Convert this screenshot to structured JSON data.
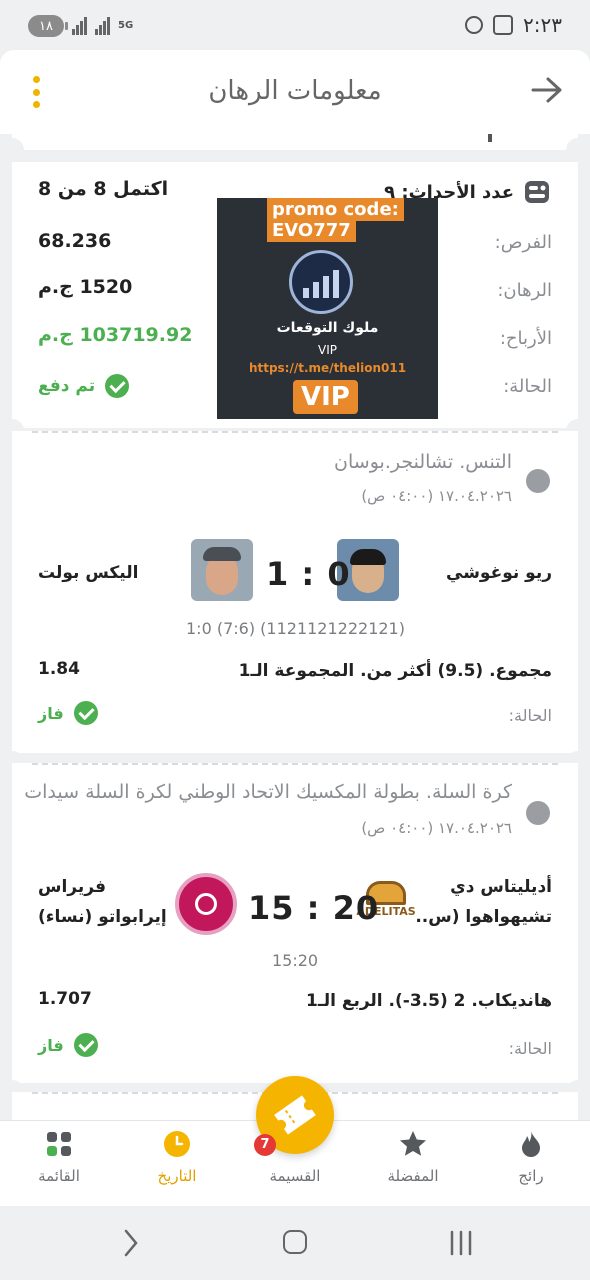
{
  "status_bar": {
    "battery": "١٨",
    "network": "5G",
    "time": "٢:٢٣"
  },
  "header": {
    "title": "معلومات الرهان"
  },
  "summary": {
    "events_label": "عدد الأحداث: ٩",
    "completed": "اكتمل 8 من 8",
    "odds_label": "الفرص:",
    "odds_value": "68.236",
    "stake_label": "الرهان:",
    "stake_value": "1520 ج.م",
    "winnings_label": "الأرباح:",
    "winnings_value": "103719.92 ج.م",
    "status_label": "الحالة:",
    "status_value": "تم دفع"
  },
  "promo": {
    "line1": "promo code:",
    "line2": "EVO777",
    "name": "ملوك التوقعات",
    "vip_small": "VIP",
    "url": "https://t.me/thelion011",
    "vip_big": "VIP"
  },
  "events": [
    {
      "title": "التنس. تشالنجر.بوسان",
      "date": "١٧.٠٤.٢٠٢٦ (٠٤:٠٠ ص)",
      "team1": "ريو نوغوشي",
      "team2": "اليكس بولت",
      "score": "1 : 0",
      "subscore": "1:0 (7:6) (1121121222121)",
      "market": "مجموع. (9.5) أكثر من. المجموعة الـ1",
      "odd": "1.84",
      "status_label": "الحالة:",
      "status_value": "فاز"
    },
    {
      "title": "كرة السلة. بطولة المكسيك الاتحاد الوطني لكرة السلة سيدات",
      "date": "١٧.٠٤.٢٠٢٦ (٠٤:٠٠ ص)",
      "team1_line1": "أديليتاس دي",
      "team1_line2": "تشيهواهوا (س..",
      "team2_line1": "فريراس",
      "team2_line2": "إيرابواتو (نساء)",
      "team1_logo": "ADELITAS",
      "score": "15 : 20",
      "subscore": "15:20",
      "market": "هانديكاب. 2 (3.5-). الربع الـ1",
      "odd": "1.707",
      "status_label": "الحالة:",
      "status_value": "فاز"
    }
  ],
  "bottom_nav": {
    "items": [
      {
        "label": "رائج",
        "icon": "fire-icon"
      },
      {
        "label": "المفضلة",
        "icon": "star-icon"
      },
      {
        "label": "القسيمة",
        "icon": "ticket-icon",
        "badge": "7"
      },
      {
        "label": "التاريخ",
        "icon": "clock-icon",
        "active": true
      },
      {
        "label": "القائمة",
        "icon": "grid-icon"
      }
    ]
  },
  "colors": {
    "accent": "#f4b400",
    "win": "#4caf50",
    "promo_orange": "#e8892c"
  }
}
